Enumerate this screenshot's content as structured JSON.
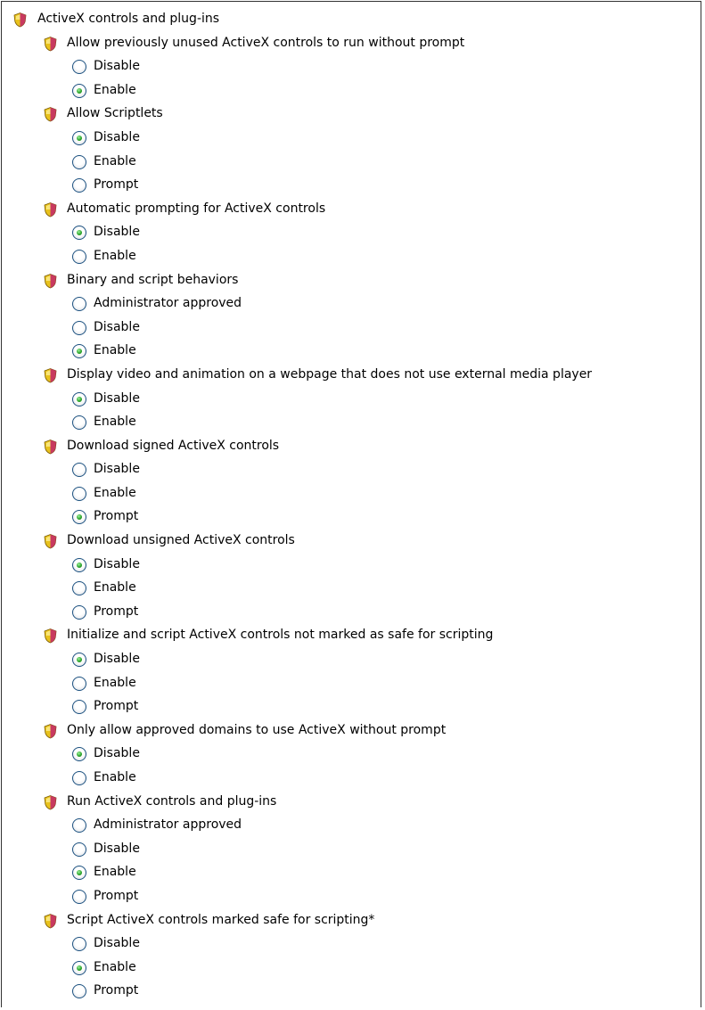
{
  "root": {
    "label": "ActiveX controls and plug-ins",
    "icon": "shield-icon"
  },
  "colors": {
    "radio_border": "#1c5180",
    "radio_dot": "#2ea52e",
    "frame": "#333333"
  },
  "categories": [
    {
      "label": "Allow previously unused ActiveX controls to run without prompt",
      "options": [
        {
          "label": "Disable",
          "selected": false
        },
        {
          "label": "Enable",
          "selected": true
        }
      ]
    },
    {
      "label": "Allow Scriptlets",
      "options": [
        {
          "label": "Disable",
          "selected": true
        },
        {
          "label": "Enable",
          "selected": false
        },
        {
          "label": "Prompt",
          "selected": false
        }
      ]
    },
    {
      "label": "Automatic prompting for ActiveX controls",
      "options": [
        {
          "label": "Disable",
          "selected": true
        },
        {
          "label": "Enable",
          "selected": false
        }
      ]
    },
    {
      "label": "Binary and script behaviors",
      "options": [
        {
          "label": "Administrator approved",
          "selected": false
        },
        {
          "label": "Disable",
          "selected": false
        },
        {
          "label": "Enable",
          "selected": true
        }
      ]
    },
    {
      "label": "Display video and animation on a webpage that does not use external media player",
      "options": [
        {
          "label": "Disable",
          "selected": true
        },
        {
          "label": "Enable",
          "selected": false
        }
      ]
    },
    {
      "label": "Download signed ActiveX controls",
      "options": [
        {
          "label": "Disable",
          "selected": false
        },
        {
          "label": "Enable",
          "selected": false
        },
        {
          "label": "Prompt",
          "selected": true
        }
      ]
    },
    {
      "label": "Download unsigned ActiveX controls",
      "options": [
        {
          "label": "Disable",
          "selected": true
        },
        {
          "label": "Enable",
          "selected": false
        },
        {
          "label": "Prompt",
          "selected": false
        }
      ]
    },
    {
      "label": "Initialize and script ActiveX controls not marked as safe for scripting",
      "options": [
        {
          "label": "Disable",
          "selected": true
        },
        {
          "label": "Enable",
          "selected": false
        },
        {
          "label": "Prompt",
          "selected": false
        }
      ]
    },
    {
      "label": "Only allow approved domains to use ActiveX without prompt",
      "options": [
        {
          "label": "Disable",
          "selected": true
        },
        {
          "label": "Enable",
          "selected": false
        }
      ]
    },
    {
      "label": "Run ActiveX controls and plug-ins",
      "options": [
        {
          "label": "Administrator approved",
          "selected": false
        },
        {
          "label": "Disable",
          "selected": false
        },
        {
          "label": "Enable",
          "selected": true
        },
        {
          "label": "Prompt",
          "selected": false
        }
      ]
    },
    {
      "label": "Script ActiveX controls marked safe for scripting*",
      "options": [
        {
          "label": "Disable",
          "selected": false
        },
        {
          "label": "Enable",
          "selected": true
        },
        {
          "label": "Prompt",
          "selected": false
        }
      ]
    }
  ]
}
